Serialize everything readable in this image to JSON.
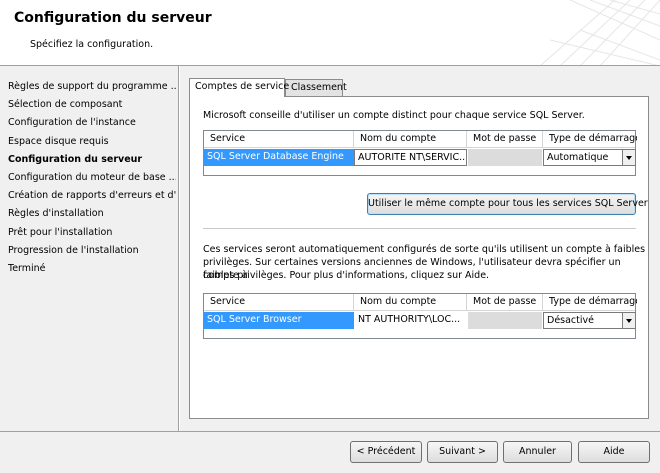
{
  "header": {
    "title": "Configuration du serveur",
    "subtitle": "Spécifiez la configuration."
  },
  "nav": {
    "items": [
      {
        "label": "Règles de support du programme ...",
        "active": false
      },
      {
        "label": "Sélection de composant",
        "active": false
      },
      {
        "label": "Configuration de l'instance",
        "active": false
      },
      {
        "label": "Espace disque requis",
        "active": false
      },
      {
        "label": "Configuration du serveur",
        "active": true
      },
      {
        "label": "Configuration du moteur de base ...",
        "active": false
      },
      {
        "label": "Création de rapports d'erreurs et d'...",
        "active": false
      },
      {
        "label": "Règles d'installation",
        "active": false
      },
      {
        "label": "Prêt pour l'installation",
        "active": false
      },
      {
        "label": "Progression de l'installation",
        "active": false
      },
      {
        "label": "Terminé",
        "active": false
      }
    ]
  },
  "tabs": [
    {
      "label": "Comptes de service",
      "selected": true
    },
    {
      "label": "Classement",
      "selected": false
    }
  ],
  "panel": {
    "intro": "Microsoft conseille d'utiliser un compte distinct pour chaque service SQL Server.",
    "columns": {
      "service": "Service",
      "account": "Nom du compte",
      "password": "Mot de passe",
      "startup": "Type de démarrage"
    },
    "grid1_rows": [
      {
        "service": "SQL Server Database Engine",
        "account": "AUTORITE NT\\SERVIC...",
        "password": "",
        "startup": "Automatique"
      }
    ],
    "same_account_button": "Utiliser le même compte pour tous les services SQL Server",
    "note_line1": "Ces services seront automatiquement configurés de sorte qu'ils utilisent un compte à faibles",
    "note_line2": "privilèges. Sur certaines versions anciennes de Windows, l'utilisateur devra spécifier un compte à",
    "note_line3": "faibles privilèges. Pour plus d'informations, cliquez sur Aide.",
    "grid2_rows": [
      {
        "service": "SQL Server Browser",
        "account": "NT AUTHORITY\\LOC...",
        "password": "",
        "startup": "Désactivé"
      }
    ]
  },
  "footer": {
    "back": "< Précédent",
    "next": "Suivant >",
    "cancel": "Annuler",
    "help": "Aide"
  },
  "colors": {
    "selection": "#3399ff",
    "window_bg": "#f0f0f0"
  }
}
